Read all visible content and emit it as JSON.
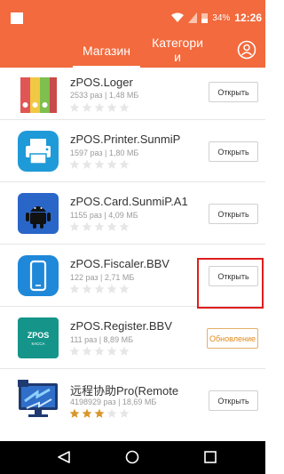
{
  "status_bar": {
    "battery": "34%",
    "time": "12:26"
  },
  "tabs": {
    "store": "Магазин",
    "categories": "Категори\nи"
  },
  "icons": {
    "profile": "profile-icon",
    "nav": [
      "back-icon",
      "home-icon",
      "recents-icon"
    ]
  },
  "apps": [
    {
      "name": "zPOS.Loger",
      "meta": "2533 раз | 1,48 МБ",
      "rating": 0,
      "button": "Открыть",
      "icon": "binders-icon"
    },
    {
      "name": "zPOS.Printer.SunmiP",
      "meta": "1597 раз | 1,80 МБ",
      "rating": 0,
      "button": "Открыть",
      "icon": "printer-icon"
    },
    {
      "name": "zPOS.Card.SunmiP.A1",
      "meta": "1155 раз | 4,09 МБ",
      "rating": 0,
      "button": "Открыть",
      "icon": "android-icon"
    },
    {
      "name": "zPOS.Fiscaler.BBV",
      "meta": "122 раз | 2,71 МБ",
      "rating": 0,
      "button": "Открыть",
      "icon": "phone-icon"
    },
    {
      "name": "zPOS.Register.BBV",
      "meta": "111 раз | 8,89 МБ",
      "rating": 0,
      "button": "Обновление",
      "icon": "zpos-kassa-icon",
      "icon_text": "ZPOS",
      "icon_subtext": "КАССА"
    },
    {
      "name": "远程协助Pro(Remote",
      "meta": "4198929 раз | 18,69 МБ",
      "rating": 3,
      "button": "Открыть",
      "icon": "remote-assist-icon"
    }
  ],
  "colors": {
    "accent": "#f26a3d",
    "update": "#e08a1c",
    "highlight": "#e11d1d",
    "star_on": "#d9962a",
    "star_off": "#e6e6e6"
  }
}
